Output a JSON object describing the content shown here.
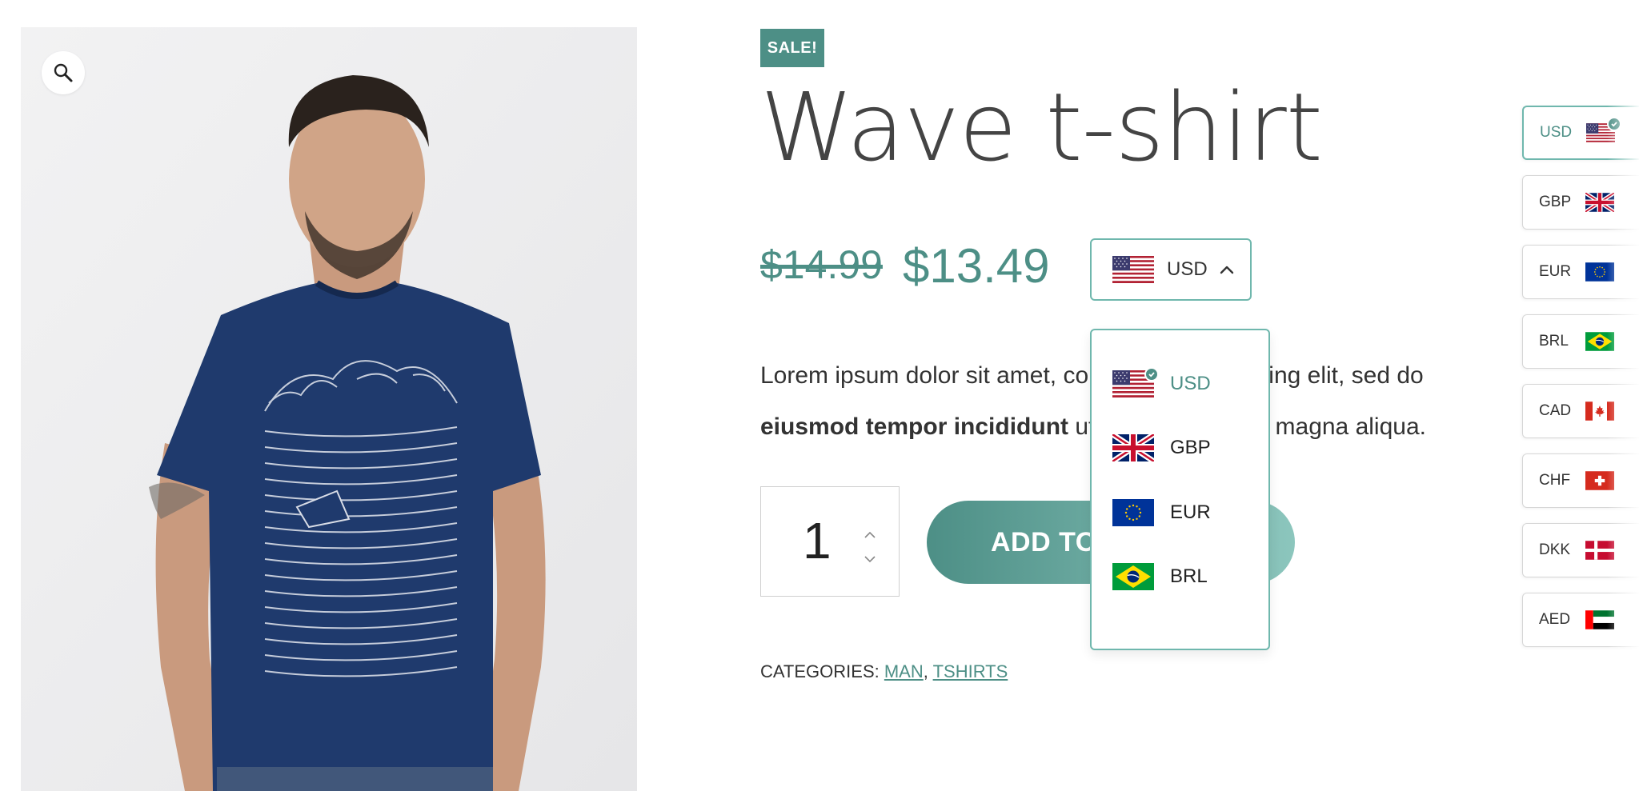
{
  "product": {
    "badge": "SALE!",
    "title": "Wave t-shirt",
    "price_old": "$14.99",
    "price_new": "$13.49",
    "description_part1": "Lorem ipsum dolor sit amet,",
    "description_hidden_mid": " consectetur adipiscing elit, sed do",
    "description_bold": "eiusmod tempor incididunt",
    "description_part2": " ut labore et dolore magna aliqua.",
    "quantity": "1",
    "add_to_cart_label": "ADD TO CART",
    "categories_label": "CATEGORIES:",
    "categories": [
      "MAN",
      "TSHIRTS"
    ]
  },
  "currency_select": {
    "selected": "USD",
    "selected_flag": "us-flag-icon"
  },
  "dropdown": {
    "items": [
      {
        "code": "USD",
        "flag": "us-flag-icon",
        "active": true
      },
      {
        "code": "GBP",
        "flag": "uk-flag-icon",
        "active": false
      },
      {
        "code": "EUR",
        "flag": "eu-flag-icon",
        "active": false
      },
      {
        "code": "BRL",
        "flag": "brazil-flag-icon",
        "active": false
      }
    ]
  },
  "side_switcher": {
    "items": [
      {
        "code": "USD",
        "flag": "us-flag-icon",
        "active": true
      },
      {
        "code": "GBP",
        "flag": "uk-flag-icon",
        "active": false
      },
      {
        "code": "EUR",
        "flag": "eu-flag-icon",
        "active": false
      },
      {
        "code": "BRL",
        "flag": "brazil-flag-icon",
        "active": false
      },
      {
        "code": "CAD",
        "flag": "canada-flag-icon",
        "active": false
      },
      {
        "code": "CHF",
        "flag": "switzerland-flag-icon",
        "active": false
      },
      {
        "code": "DKK",
        "flag": "denmark-flag-icon",
        "active": false
      },
      {
        "code": "AED",
        "flag": "uae-flag-icon",
        "active": false
      }
    ]
  },
  "colors": {
    "accent": "#4d8f86",
    "accent_light": "#6fb7ad",
    "text": "#333333"
  },
  "icons": {
    "zoom": "magnifier-icon",
    "chevron": "chevron-up-icon",
    "check": "check-icon"
  }
}
